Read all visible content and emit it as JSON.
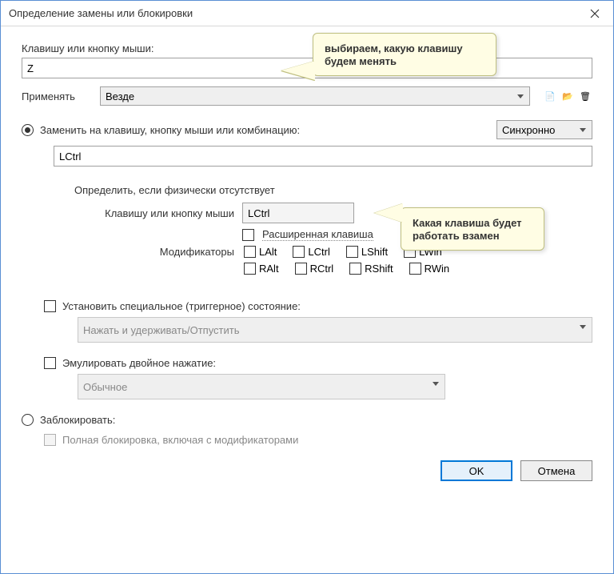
{
  "title": "Определение замены или блокировки",
  "source_key_label": "Клавишу или кнопку мыши:",
  "source_key_value": "Z",
  "apply_label": "Применять",
  "apply_value": "Везде",
  "replace_option": "Заменить на клавишу, кнопку мыши или комбинацию:",
  "sync_value": "Синхронно",
  "target_key_value": "LCtrl",
  "define_absent_title": "Определить, если физически отсутствует",
  "inner_key_label": "Клавишу или кнопку мыши",
  "inner_key_value": "LCtrl",
  "extended_label": "Расширенная клавиша",
  "modifiers_label": "Модификаторы",
  "modifiers_row1": [
    "LAlt",
    "LCtrl",
    "LShift",
    "LWin"
  ],
  "modifiers_row2": [
    "RAlt",
    "RCtrl",
    "RShift",
    "RWin"
  ],
  "trigger_state_label": "Установить специальное (триггерное) состояние:",
  "trigger_state_value": "Нажать и удерживать/Отпустить",
  "double_press_label": "Эмулировать двойное нажатие:",
  "double_press_value": "Обычное",
  "block_option": "Заблокировать:",
  "full_block_label": "Полная блокировка, включая с модификаторами",
  "ok_btn": "OK",
  "cancel_btn": "Отмена",
  "callout1": "выбираем, какую клавишу будем менять",
  "callout2": "Какая клавиша будет работать взамен"
}
